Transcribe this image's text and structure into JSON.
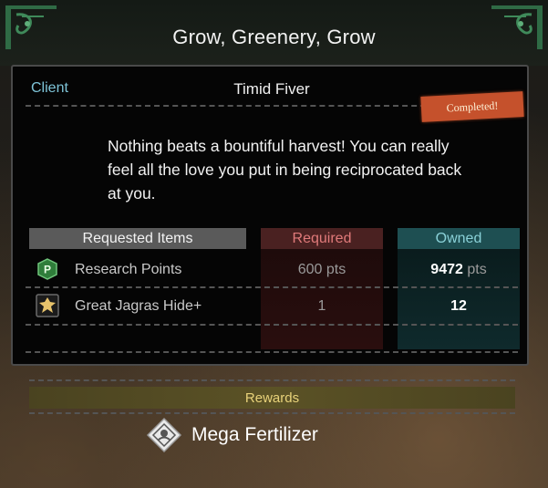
{
  "quest": {
    "title": "Grow, Greenery, Grow"
  },
  "client": {
    "label": "Client",
    "name": "Timid Fiver",
    "status": "Completed!",
    "description": "Nothing beats a bountiful harvest! You can really feel all the love you put in being reciprocated back at you."
  },
  "table": {
    "headers": {
      "items": "Requested Items",
      "required": "Required",
      "owned": "Owned"
    },
    "rows": [
      {
        "icon": "research-points-icon",
        "name": "Research Points",
        "required": "600",
        "required_unit": "pts",
        "owned": "9472",
        "owned_unit": "pts"
      },
      {
        "icon": "hide-material-icon",
        "name": "Great Jagras Hide+",
        "required": "1",
        "owned": "12"
      }
    ]
  },
  "rewards": {
    "label": "Rewards",
    "item": {
      "icon": "fertilizer-icon",
      "name": "Mega Fertilizer"
    }
  },
  "colors": {
    "client_label": "#7ec4d8",
    "stamp": "#c5512c",
    "required_header": "#4a2121",
    "owned_header": "#1e4f52",
    "rewards_bar": "#5b5226"
  }
}
